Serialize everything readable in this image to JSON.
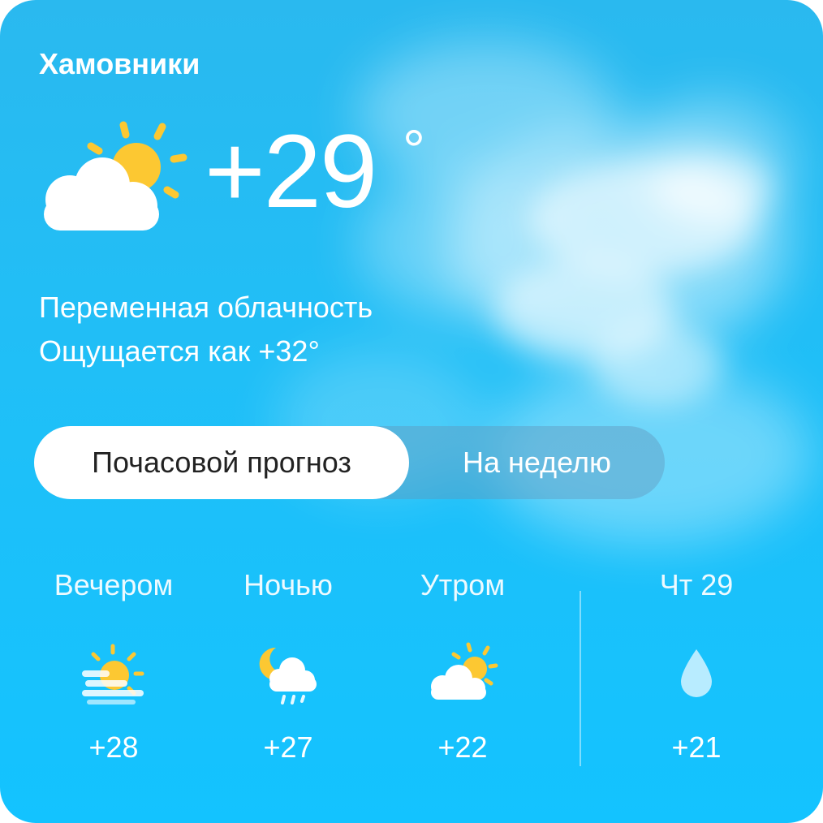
{
  "location": "Хамовники",
  "current": {
    "temperature": "+29",
    "degree_symbol": "°",
    "condition": "Переменная облачность",
    "feels_like": "Ощущается как +32°",
    "icon": "partly-cloudy-day-icon"
  },
  "tabs": [
    {
      "label": "Почасовой прогноз",
      "active": true
    },
    {
      "label": "На неделю",
      "active": false
    }
  ],
  "forecast": [
    {
      "label": "Вечером",
      "icon": "sun-haze-icon",
      "temp": "+28"
    },
    {
      "label": "Ночью",
      "icon": "night-cloud-rain-icon",
      "temp": "+27"
    },
    {
      "label": "Утром",
      "icon": "partly-cloudy-day-icon",
      "temp": "+22"
    }
  ],
  "next_day": {
    "label": "Чт 29",
    "icon": "raindrop-icon",
    "temp": "+21"
  },
  "colors": {
    "sky": "#13c3ff",
    "sun": "#fcc832",
    "cloud": "#ffffff",
    "drop": "#b8ecff"
  }
}
